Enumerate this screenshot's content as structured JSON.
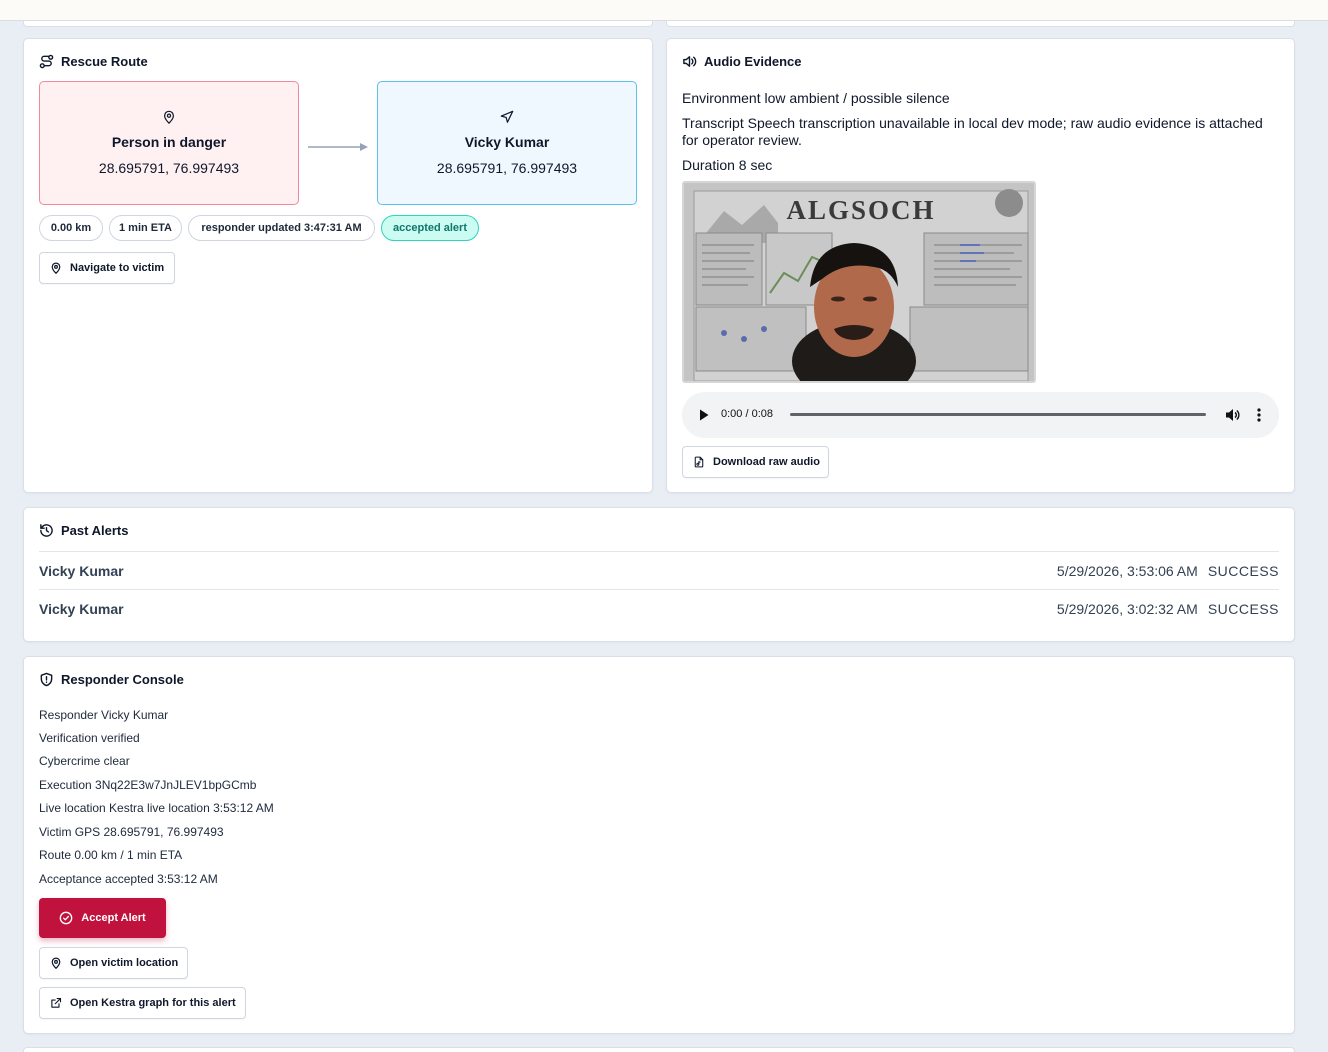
{
  "rescue_route": {
    "title": "Rescue Route",
    "victim": {
      "title": "Person in danger",
      "coords": "28.695791, 76.997493"
    },
    "responder": {
      "title": "Vicky Kumar",
      "coords": "28.695791, 76.997493"
    },
    "pills": {
      "distance": "0.00 km",
      "eta": "1 min ETA",
      "updated": "responder updated 3:47:31 AM",
      "status": "accepted alert"
    },
    "navigate_label": "Navigate to victim"
  },
  "audio_evidence": {
    "title": "Audio Evidence",
    "environment": "Environment low ambient / possible silence",
    "transcript": "Transcript Speech transcription unavailable in local dev mode; raw audio evidence is attached for operator review.",
    "duration": "Duration 8 sec",
    "video_overlay_text": "ALGSOCH",
    "player_time": "0:00 / 0:08",
    "download_label": "Download raw audio"
  },
  "past_alerts": {
    "title": "Past Alerts",
    "items": [
      {
        "name": "Vicky Kumar",
        "time": "5/29/2026, 3:53:06 AM",
        "status": "SUCCESS"
      },
      {
        "name": "Vicky Kumar",
        "time": "5/29/2026, 3:02:32 AM",
        "status": "SUCCESS"
      }
    ]
  },
  "responder_console": {
    "title": "Responder Console",
    "lines": [
      "Responder Vicky Kumar",
      "Verification verified",
      "Cybercrime clear",
      "Execution 3Nq22E3w7JnJLEV1bpGCmb",
      "Live location Kestra live location 3:53:12 AM",
      "Victim GPS 28.695791, 76.997493",
      "Route 0.00 km / 1 min ETA",
      "Acceptance accepted 3:53:12 AM"
    ],
    "accept_label": "Accept Alert",
    "open_location_label": "Open victim location",
    "open_graph_label": "Open Kestra graph for this alert"
  },
  "colors": {
    "accent": "#c0123c",
    "danger_border": "#f08a9b",
    "responder_border": "#5cc2e6",
    "accepted_bg": "#ccfbf1",
    "accepted_text": "#0f766e"
  }
}
